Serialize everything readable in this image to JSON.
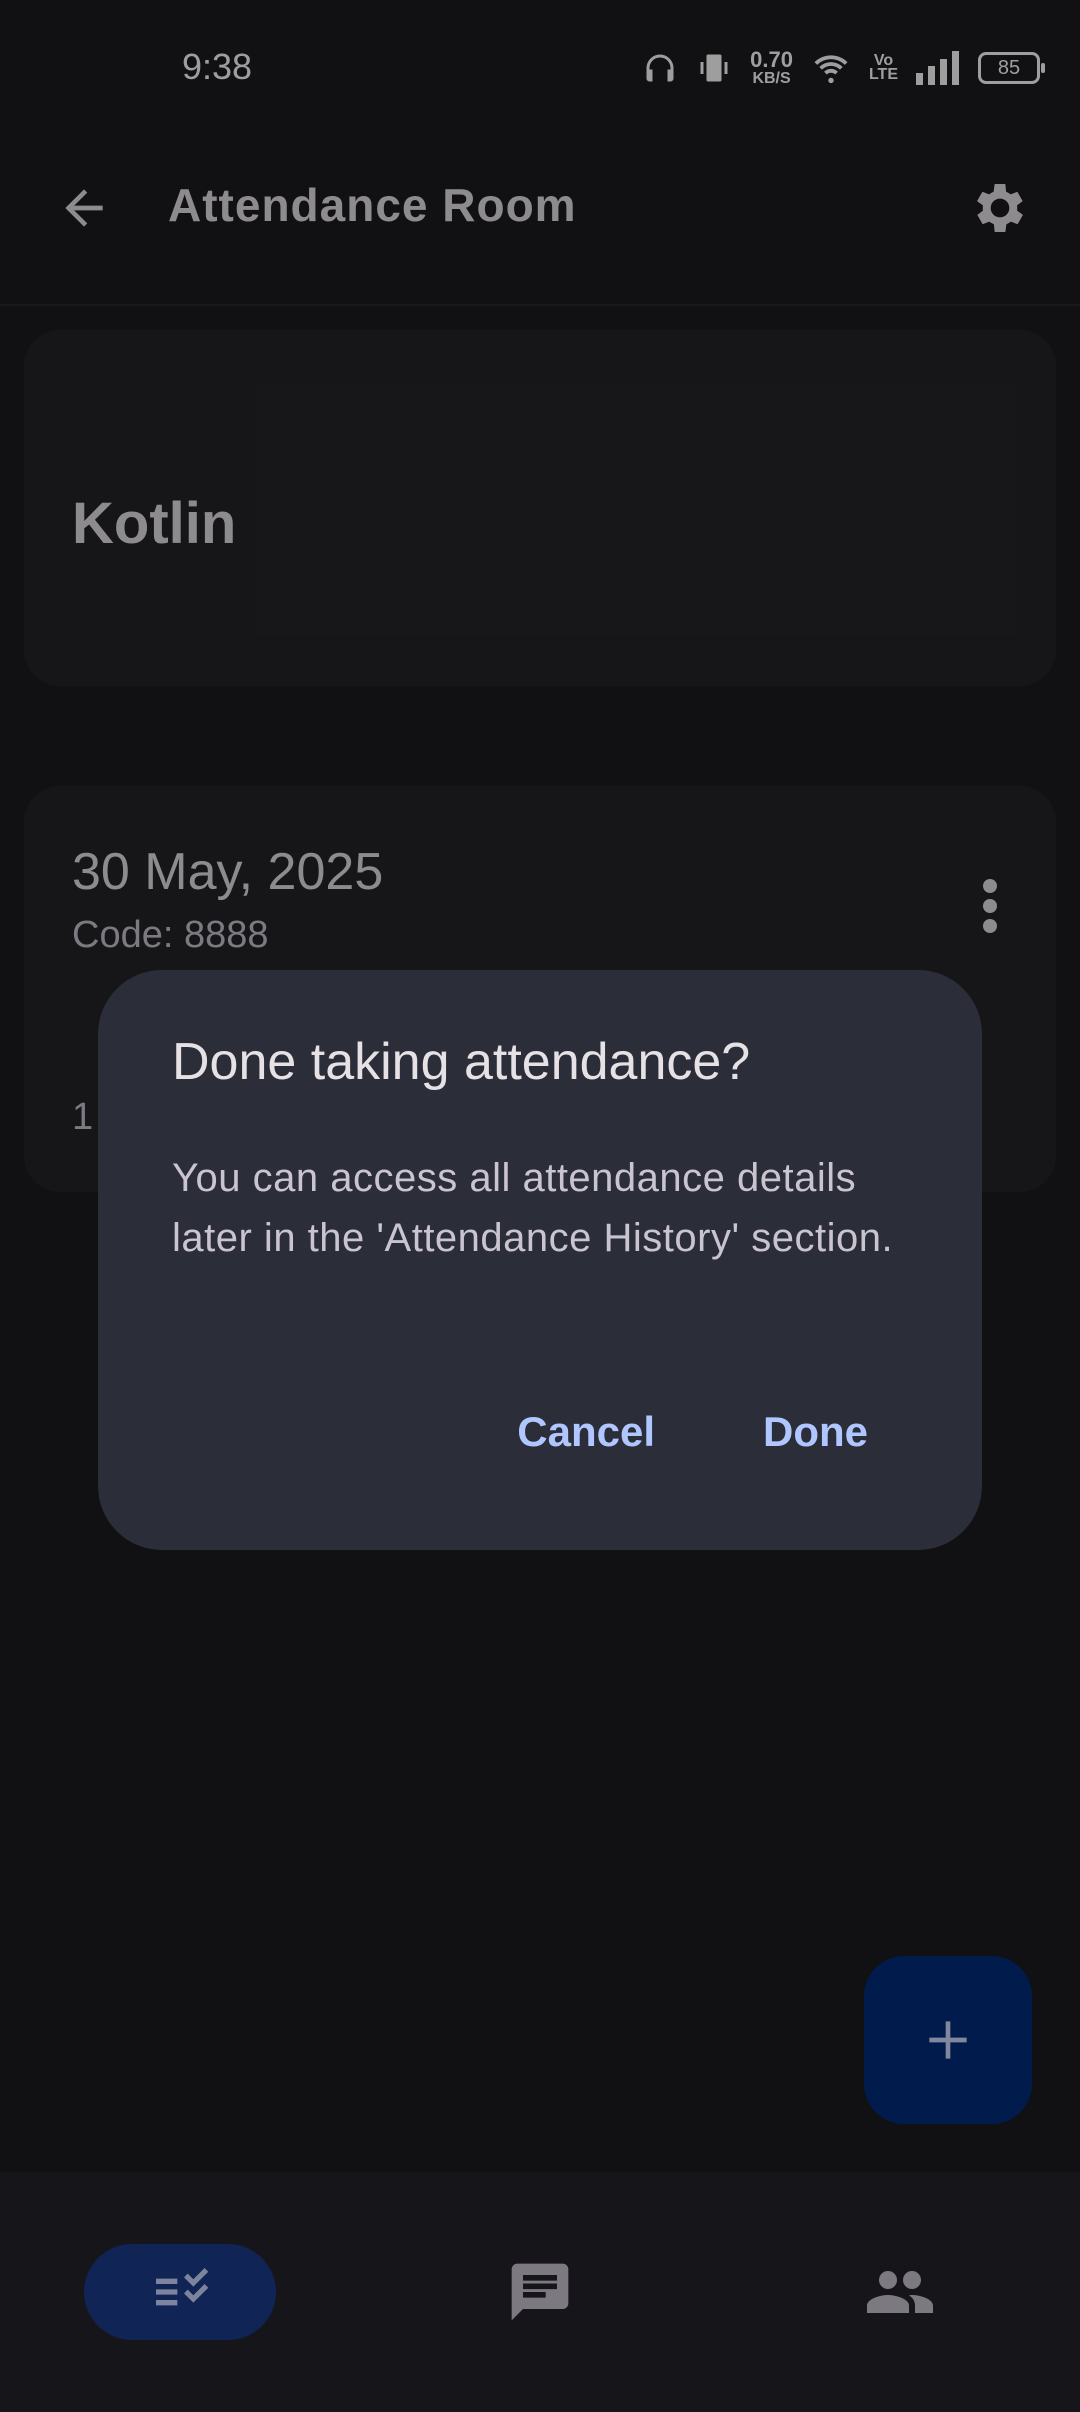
{
  "status_bar": {
    "time": "9:38",
    "net_speed_value": "0.70",
    "net_speed_unit": "KB/S",
    "volte_top": "Vo",
    "volte_bottom": "LTE",
    "battery": "85",
    "icons": [
      "headphones-icon",
      "vibrate-icon",
      "wifi-icon",
      "signal-icon",
      "battery-icon"
    ]
  },
  "app_bar": {
    "title": "Attendance Room",
    "back_icon": "arrow-back-icon",
    "settings_icon": "gear-icon"
  },
  "class_card": {
    "name": "Kotlin"
  },
  "session_card": {
    "date": "30 May, 2025",
    "code": "Code: 8888",
    "count": "1"
  },
  "dialog": {
    "title": "Done taking attendance?",
    "body": "You can access all attendance details later in the 'Attendance History' section.",
    "cancel_label": "Cancel",
    "done_label": "Done"
  },
  "fab": {
    "icon": "add-icon"
  },
  "bottom_nav": {
    "items": [
      {
        "icon": "checklist-icon",
        "selected": true
      },
      {
        "icon": "chat-icon",
        "selected": false
      },
      {
        "icon": "people-icon",
        "selected": false
      }
    ]
  },
  "colors": {
    "background": "#1c1b1f",
    "dialog": "#2b2d38",
    "accent_text": "#b0c6ff",
    "fab": "#032d7d",
    "nav_indicator": "#1a3c8c"
  }
}
